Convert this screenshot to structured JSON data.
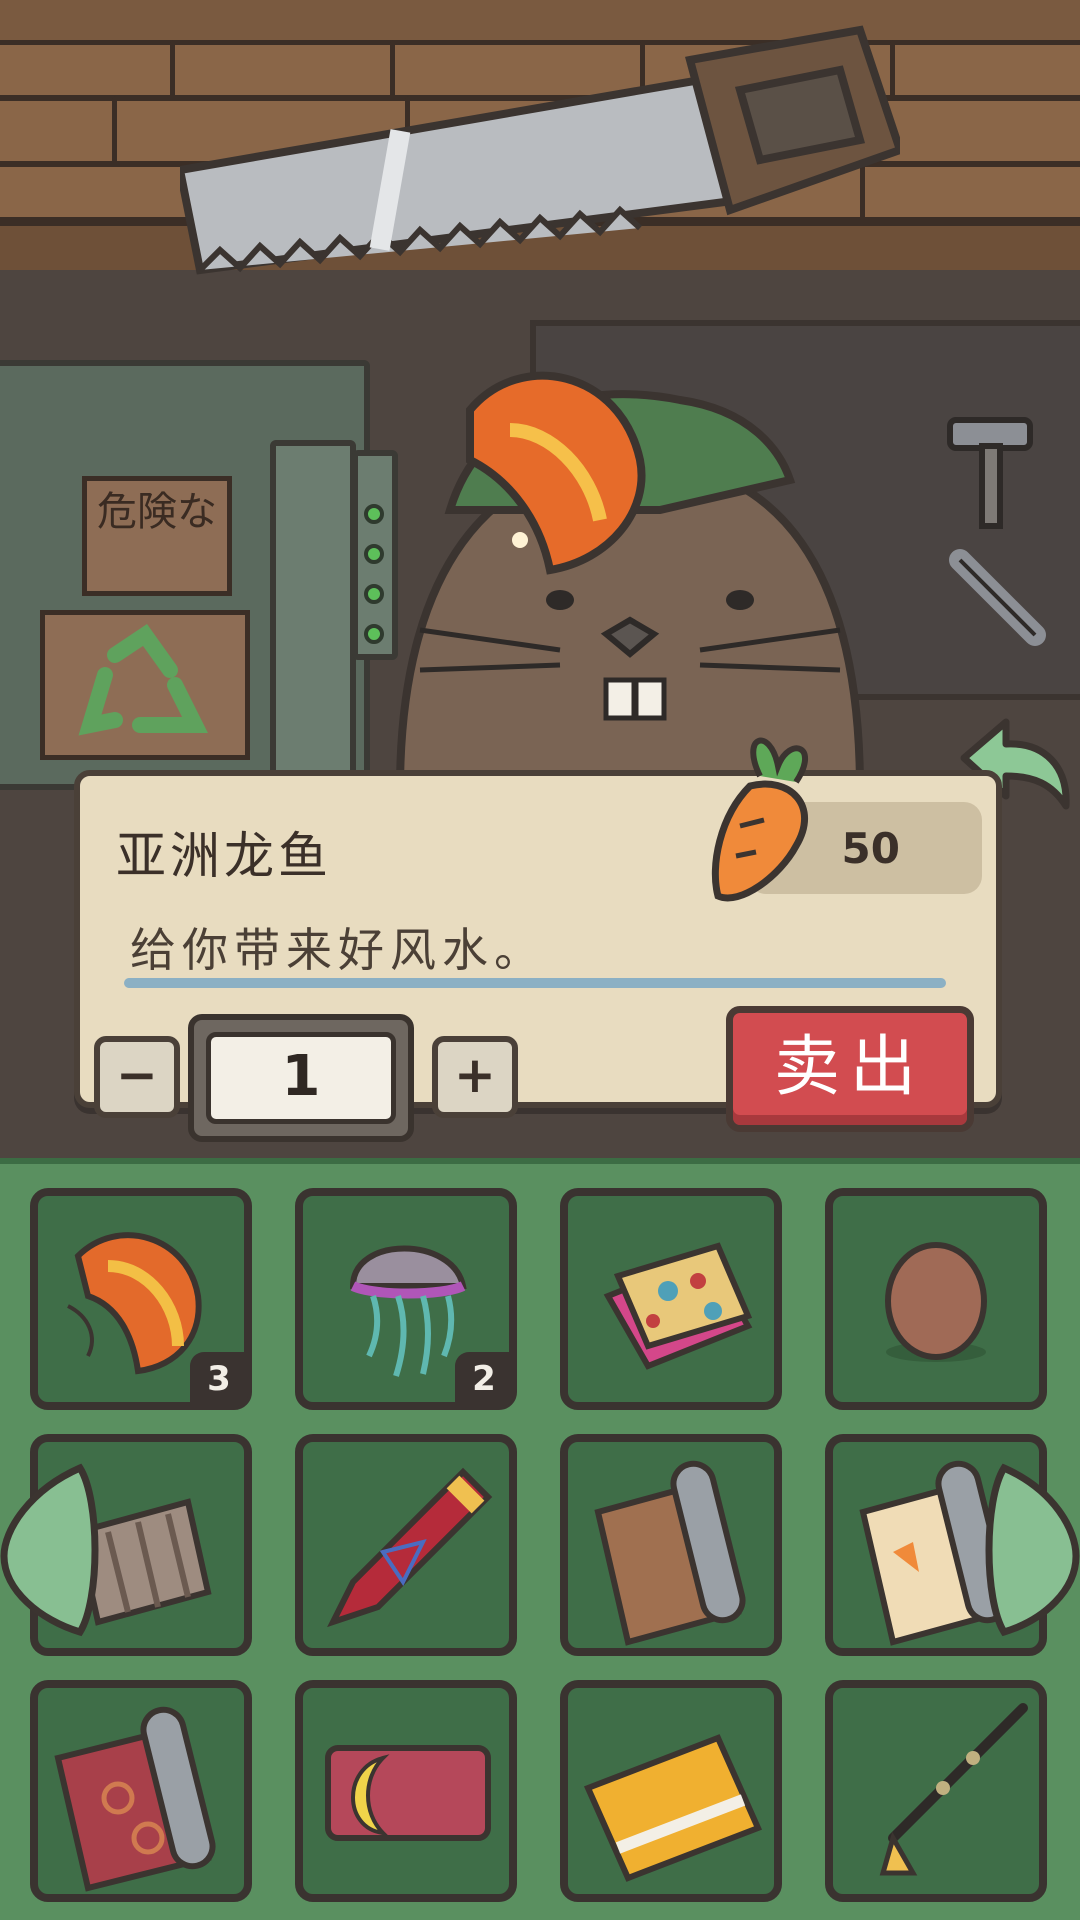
{
  "dialog": {
    "item_name": "亚洲龙鱼",
    "price_icon": "carrot-icon",
    "price": "50",
    "description": "给你带来好风水。",
    "minus_label": "−",
    "quantity": "1",
    "plus_label": "+",
    "sell_label": "卖出"
  },
  "scene": {
    "sign_text": "危険な"
  },
  "inventory": {
    "slots": [
      {
        "icon": "arowana-fish-icon",
        "count": "3"
      },
      {
        "icon": "jellyfish-icon",
        "count": "2"
      },
      {
        "icon": "patterned-cloth-icon",
        "count": ""
      },
      {
        "icon": "egg-icon",
        "count": ""
      },
      {
        "icon": "yarn-roll-icon",
        "count": ""
      },
      {
        "icon": "crayon-icon",
        "count": ""
      },
      {
        "icon": "brown-paper-roll-icon",
        "count": ""
      },
      {
        "icon": "carrot-paper-roll-icon",
        "count": ""
      },
      {
        "icon": "red-wallpaper-roll-icon",
        "count": ""
      },
      {
        "icon": "moon-card-icon",
        "count": ""
      },
      {
        "icon": "vip-card-icon",
        "count": ""
      },
      {
        "icon": "fishing-rod-icon",
        "count": ""
      }
    ]
  },
  "colors": {
    "sell_button": "#d24c50",
    "inventory_bg": "#5a9060",
    "panel_bg": "#e8dcc0"
  }
}
